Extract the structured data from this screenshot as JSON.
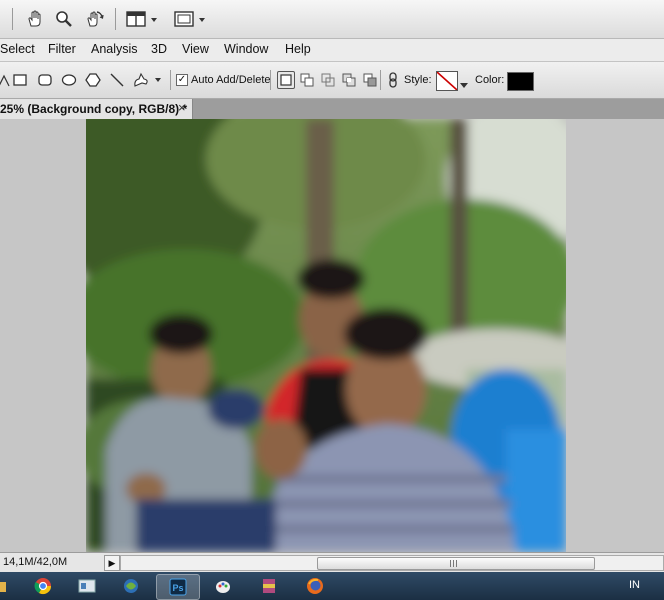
{
  "menu": [
    "Select",
    "Filter",
    "Analysis",
    "3D",
    "View",
    "Window",
    "Help"
  ],
  "options": {
    "auto_add_delete_label": "Auto Add/Delete",
    "auto_add_delete_checked": true,
    "style_label": "Style:",
    "color_label": "Color:",
    "color_value": "#000000"
  },
  "document": {
    "tab_title": "25% (Background copy, RGB/8) *",
    "close_glyph": "×"
  },
  "status": {
    "doc_size": "14,1M/42,0M"
  },
  "taskbar": {
    "apps": [
      "windows-explorer",
      "chrome",
      "file-manager",
      "network",
      "photoshop",
      "paint",
      "winrar",
      "firefox"
    ],
    "active_app": "photoshop",
    "language": "IN"
  },
  "icons": {
    "hand": "hand-icon",
    "zoom": "zoom-icon",
    "rotate": "rotate-view-icon",
    "arrange": "arrange-documents-icon",
    "screen_mode": "screen-mode-icon"
  }
}
